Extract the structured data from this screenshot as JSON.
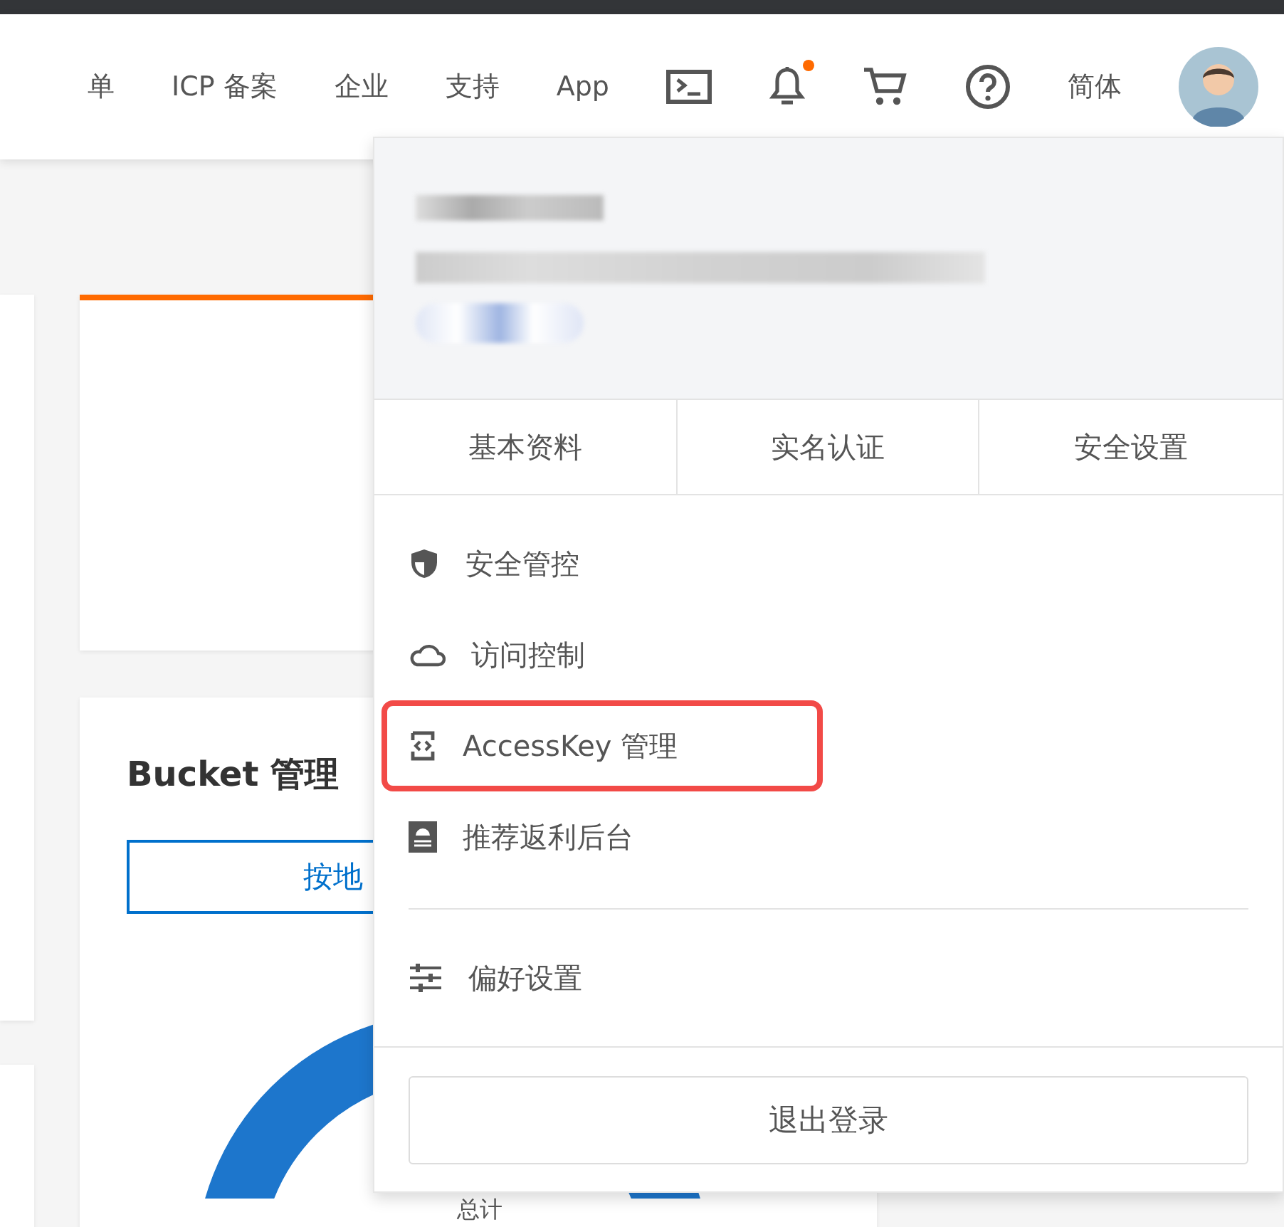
{
  "nav": {
    "items": [
      "单",
      "ICP 备案",
      "企业",
      "支持",
      "App"
    ],
    "notification_dot": true,
    "language": "简体"
  },
  "cards": {
    "bucket_title": "Bucket 管理",
    "region_button": "按地",
    "donut_center": "总计"
  },
  "account_menu": {
    "tabs": [
      "基本资料",
      "实名认证",
      "安全设置"
    ],
    "items": [
      {
        "label": "安全管控",
        "kind": "shield",
        "highlighted": false
      },
      {
        "label": "访问控制",
        "kind": "cloud",
        "highlighted": false
      },
      {
        "label": "AccessKey 管理",
        "kind": "key",
        "highlighted": true
      },
      {
        "label": "推荐返利后台",
        "kind": "rebate",
        "highlighted": false
      }
    ],
    "settings_items": [
      {
        "label": "偏好设置",
        "kind": "sliders",
        "highlighted": false
      }
    ],
    "logout": "退出登录"
  }
}
